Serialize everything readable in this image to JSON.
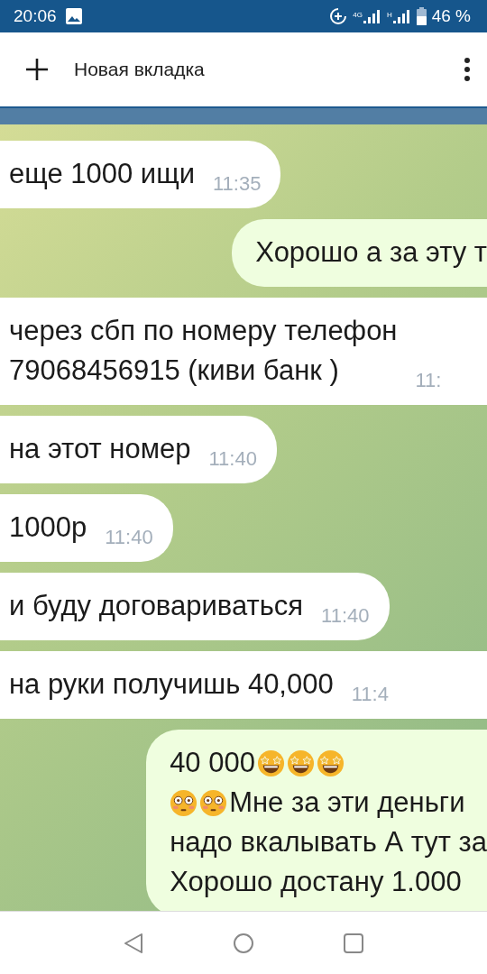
{
  "status_bar": {
    "time": "20:06",
    "network_labels": [
      "4G",
      "H"
    ],
    "battery_text": "46 %"
  },
  "app_bar": {
    "title": "Новая вкладка"
  },
  "messages": [
    {
      "kind": "incoming",
      "lines": [
        {
          "text": "еще 1000 ищи"
        }
      ],
      "time": "11:35",
      "cut": false
    },
    {
      "kind": "outgoing",
      "lines": [
        {
          "text": "Хорошо а за эту т"
        }
      ],
      "cut": true
    },
    {
      "kind": "incoming",
      "lines": [
        {
          "text": "через сбп по номеру телефон"
        },
        {
          "text": "79068456915 (киви банк )"
        }
      ],
      "time": "11:",
      "cut": true
    },
    {
      "kind": "incoming",
      "lines": [
        {
          "text": "на этот номер"
        }
      ],
      "time": "11:40",
      "cut": false
    },
    {
      "kind": "incoming",
      "lines": [
        {
          "text": "1000р"
        }
      ],
      "time": "11:40",
      "cut": false
    },
    {
      "kind": "incoming",
      "lines": [
        {
          "text": "и буду договариваться"
        }
      ],
      "time": "11:40",
      "cut": false
    },
    {
      "kind": "incoming",
      "lines": [
        {
          "text": "на руки получишь 40,000"
        }
      ],
      "time": "11:4",
      "cut": true
    },
    {
      "kind": "outgoing",
      "lines": [
        {
          "parts": [
            {
              "kind": "text",
              "text": "40 000"
            },
            {
              "kind": "star_emoji"
            },
            {
              "kind": "star_emoji"
            },
            {
              "kind": "star_emoji"
            }
          ]
        },
        {
          "parts": [
            {
              "kind": "flushed_emoji"
            },
            {
              "kind": "flushed_emoji"
            },
            {
              "kind": "text",
              "text": "Мне за эти деньги"
            }
          ]
        },
        {
          "text": "надо вкалывать А тут за"
        },
        {
          "text": "Хорошо достану 1.000"
        }
      ],
      "cut": true
    }
  ]
}
